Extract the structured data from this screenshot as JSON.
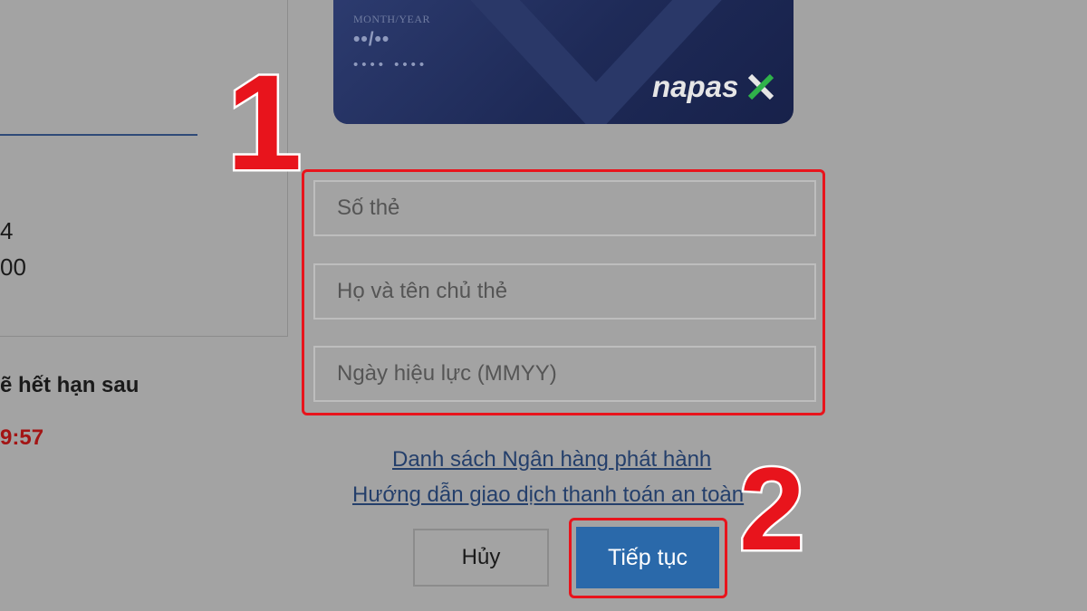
{
  "left": {
    "line1": "4",
    "line2": "00",
    "expire_text": "ẽ hết hạn sau",
    "expire_time": "9:57"
  },
  "card": {
    "label": "MONTH/YEAR",
    "date": "••/••",
    "digits": "•••• ••••",
    "brand": "napas"
  },
  "annotations": {
    "step1": "1",
    "step2": "2"
  },
  "form": {
    "card_number_placeholder": "Số thẻ",
    "holder_name_placeholder": "Họ và tên chủ thẻ",
    "valid_date_placeholder": "Ngày hiệu lực (MMYY)"
  },
  "links": {
    "bank_list": "Danh sách Ngân hàng phát hành",
    "safe_guide": "Hướng dẫn giao dịch thanh toán an toàn"
  },
  "buttons": {
    "cancel": "Hủy",
    "continue": "Tiếp tục"
  },
  "colors": {
    "highlight": "#e8141c",
    "primary": "#2a69aa",
    "card": "#1e2a57",
    "link": "#243f6b"
  }
}
